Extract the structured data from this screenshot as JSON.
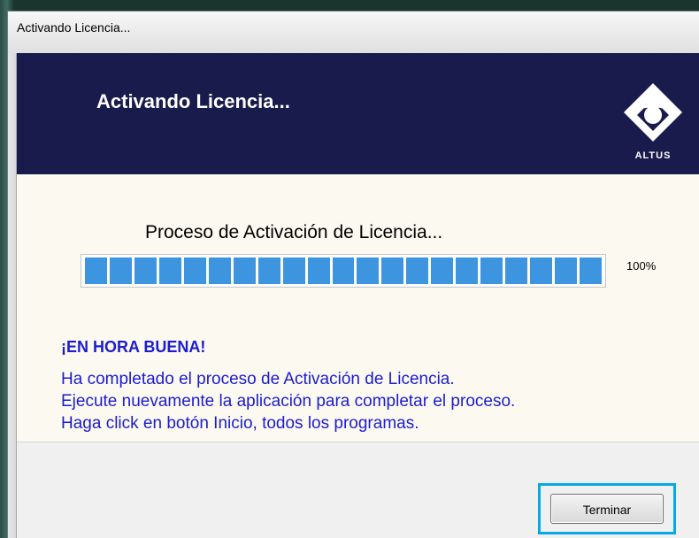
{
  "window": {
    "title": "Activando Licencia..."
  },
  "banner": {
    "title": "Activando Licencia...",
    "logo_icon": "altus-logo-icon",
    "logo_text": "ALTUS"
  },
  "progress": {
    "title": "Proceso de Activación de Licencia...",
    "value": 1.0,
    "percent_text": "100%"
  },
  "message": {
    "congrats": "¡EN HORA BUENA!",
    "lines": [
      "Ha completado el proceso de Activación de Licencia.",
      "Ejecute nuevamente la aplicación para completar el proceso.",
      "Haga click en botón Inicio, todos los programas."
    ]
  },
  "footer": {
    "terminate_label": "Terminar"
  },
  "colors": {
    "banner_bg": "#191b4d",
    "content_bg": "#fcf9f0",
    "progress_fill": "#3d95e0",
    "message_text": "#1c1ccf",
    "highlight": "#05a9e8"
  }
}
